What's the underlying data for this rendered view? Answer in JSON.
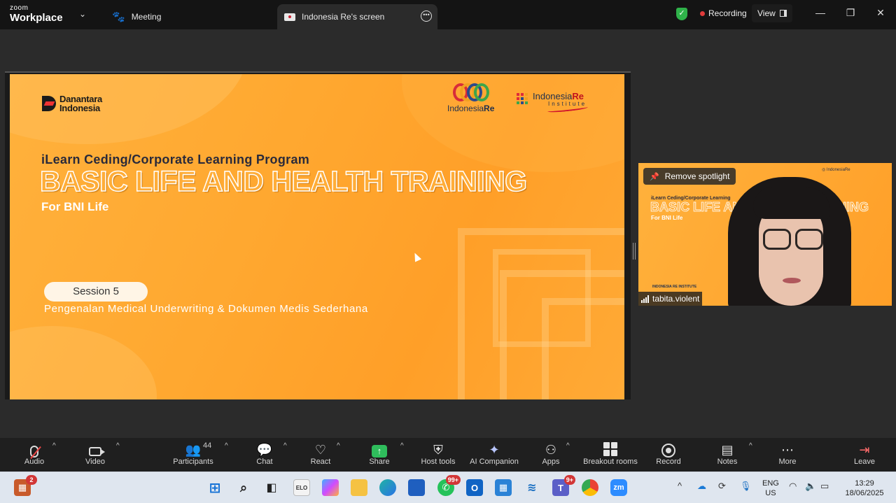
{
  "titlebar": {
    "brand_top": "zoom",
    "brand_bottom": "Workplace",
    "tabs": [
      {
        "label": "Meeting"
      },
      {
        "label": "Indonesia Re's screen"
      }
    ],
    "recording_label": "Recording",
    "view_label": "View"
  },
  "slide": {
    "logo_left": [
      "Danantara",
      "Indonesia"
    ],
    "logo_center": {
      "part1": "Indonesia",
      "part2": "Re"
    },
    "logo_right": {
      "part1": "Indonesia",
      "part2": "Re",
      "sub": "Institute"
    },
    "program": "iLearn Ceding/Corporate Learning Program",
    "title": "BASIC LIFE AND HEALTH TRAINING",
    "subtitle": "For BNI Life",
    "session": "Session 5",
    "session_subtitle": "Pengenalan Medical Underwriting & Dokumen Medis Sederhana"
  },
  "video_tile": {
    "spotlight_label": "Remove spotlight",
    "participant_name": "tabita.violent",
    "mini_program": "iLearn Ceding/Corporate Learning",
    "mini_title": "BASIC LIFE AND HEALTH TRAINING",
    "mini_subtitle": "For BNI Life",
    "mini_footer": "INDONESIA RE INSTITUTE"
  },
  "toolbar": {
    "audio": "Audio",
    "video": "Video",
    "participants": "Participants",
    "participants_count": "44",
    "chat": "Chat",
    "react": "React",
    "share": "Share",
    "host_tools": "Host tools",
    "ai_companion": "AI Companion",
    "apps": "Apps",
    "breakout_rooms": "Breakout rooms",
    "record": "Record",
    "notes": "Notes",
    "more": "More",
    "leave": "Leave"
  },
  "taskbar": {
    "widgets_badge": "2",
    "app_elo": "ELO",
    "whatsapp_badge": "99+",
    "teams_badge": "9+",
    "zoom_label": "zm",
    "lang_top": "ENG",
    "lang_bottom": "US",
    "time": "13:29",
    "date": "18/06/2025"
  },
  "colors": {
    "slide_orange": "#ffa830",
    "recording_dot": "#e13b3b",
    "share_green": "#2fbd5c",
    "shield_green": "#2fb24a"
  }
}
